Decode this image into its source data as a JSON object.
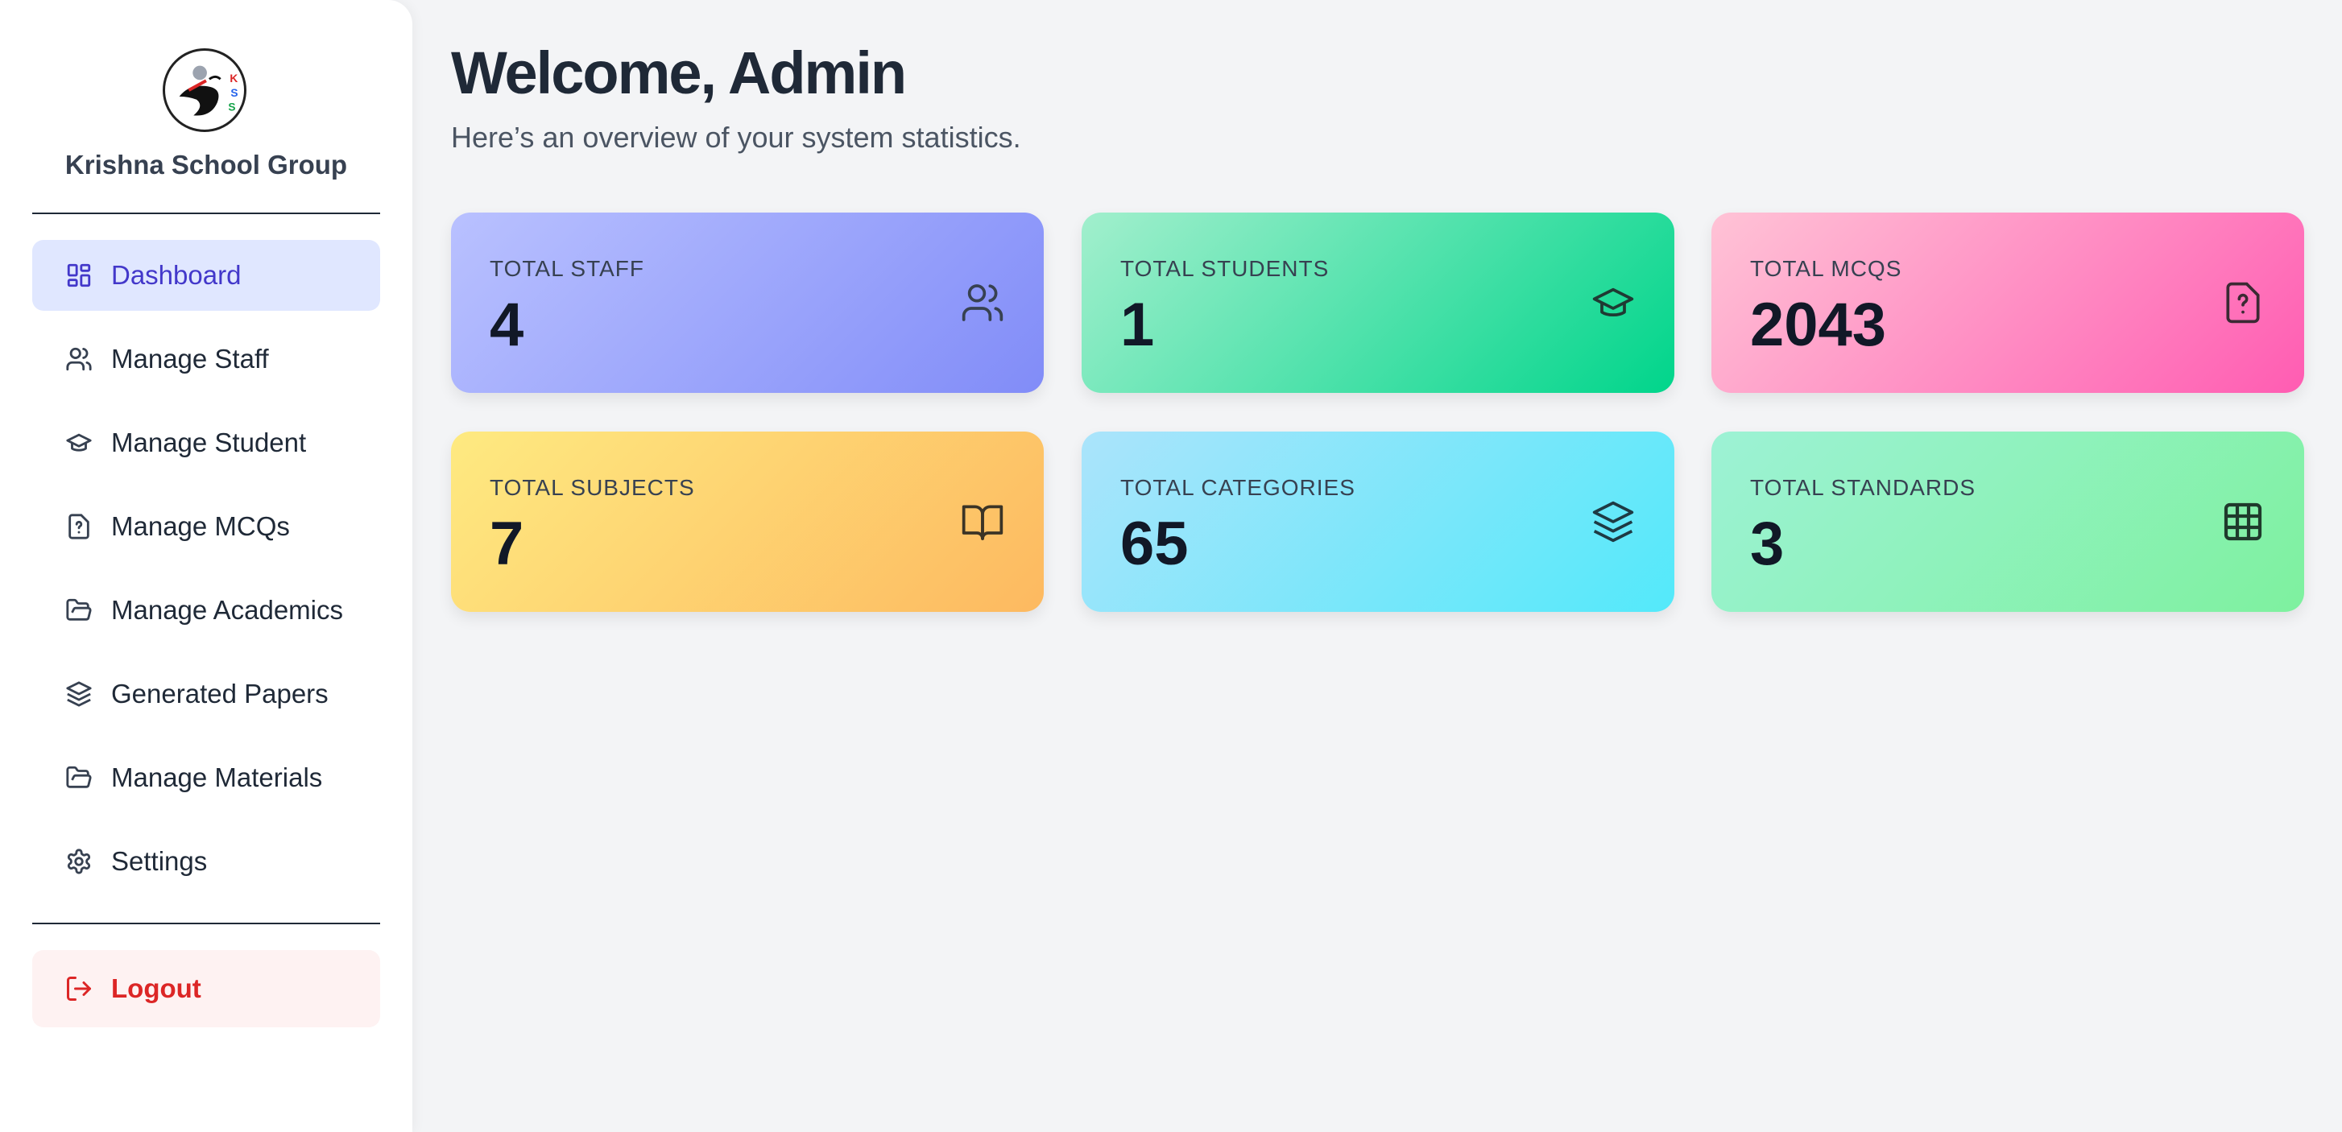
{
  "sidebar": {
    "brand": "Krishna School Group",
    "logo_letters": [
      "K",
      "S",
      "S"
    ],
    "items": [
      {
        "label": "Dashboard",
        "icon": "dashboard-icon",
        "active": true
      },
      {
        "label": "Manage Staff",
        "icon": "users-icon"
      },
      {
        "label": "Manage Student",
        "icon": "graduation-cap-icon"
      },
      {
        "label": "Manage MCQs",
        "icon": "question-file-icon"
      },
      {
        "label": "Manage Academics",
        "icon": "folder-open-icon"
      },
      {
        "label": "Generated Papers",
        "icon": "layers-icon"
      },
      {
        "label": "Manage Materials",
        "icon": "folder-open-icon"
      },
      {
        "label": "Settings",
        "icon": "gear-icon"
      }
    ],
    "logout": "Logout"
  },
  "main": {
    "title": "Welcome, Admin",
    "subtitle": "Here’s an overview of your system statistics."
  },
  "cards": [
    {
      "label": "TOTAL STAFF",
      "value": "4",
      "icon": "users-icon"
    },
    {
      "label": "TOTAL STUDENTS",
      "value": "1",
      "icon": "graduation-cap-icon"
    },
    {
      "label": "TOTAL MCQS",
      "value": "2043",
      "icon": "question-file-icon"
    },
    {
      "label": "TOTAL SUBJECTS",
      "value": "7",
      "icon": "open-book-icon"
    },
    {
      "label": "TOTAL CATEGORIES",
      "value": "65",
      "icon": "layers-icon"
    },
    {
      "label": "TOTAL STANDARDS",
      "value": "3",
      "icon": "grid-icon"
    }
  ],
  "colors": {
    "active_bg": "#e0e7ff",
    "active_text": "#4338ca",
    "logout_bg": "#fef2f2",
    "logout_text": "#dc2626",
    "page_bg": "#f3f4f6"
  }
}
